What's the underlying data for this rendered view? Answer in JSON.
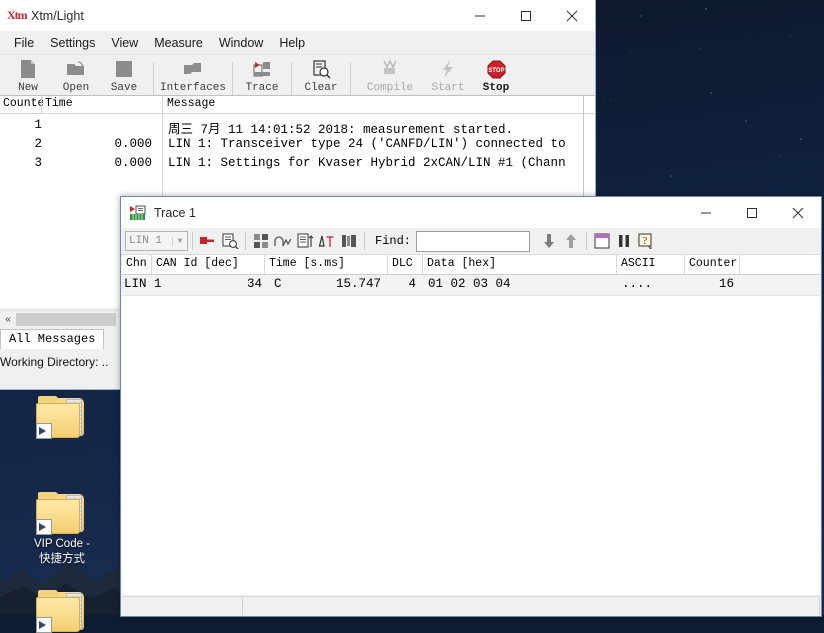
{
  "desktop": {
    "icons": [
      {
        "name": "folder-shortcut-top",
        "label": ""
      },
      {
        "name": "vip-code-shortcut",
        "label": "VIP Code -\n快捷方式"
      },
      {
        "name": "folder-shortcut-bottom",
        "label": ""
      }
    ],
    "vip_label_line1": "VIP Code -",
    "vip_label_line2": "快捷方式"
  },
  "main_window": {
    "title": "Xtm/Light",
    "logo_text": "Xtm",
    "controls": {
      "minimize": "minimize-icon",
      "maximize": "maximize-icon",
      "close": "close-icon"
    },
    "menu": [
      {
        "label": "File"
      },
      {
        "label": "Settings"
      },
      {
        "label": "View"
      },
      {
        "label": "Measure"
      },
      {
        "label": "Window"
      },
      {
        "label": "Help"
      }
    ],
    "toolbar": [
      {
        "label": "New",
        "icon": "new-file-icon",
        "enabled": true
      },
      {
        "label": "Open",
        "icon": "open-folder-icon",
        "enabled": true
      },
      {
        "label": "Save",
        "icon": "save-disk-icon",
        "enabled": true
      },
      {
        "label": "Interfaces",
        "icon": "interfaces-icon",
        "enabled": true
      },
      {
        "label": "Trace",
        "icon": "trace-icon",
        "enabled": true
      },
      {
        "label": "Clear",
        "icon": "clear-icon",
        "enabled": true
      },
      {
        "label": "Compile",
        "icon": "compile-icon",
        "enabled": false
      },
      {
        "label": "Start",
        "icon": "start-lightning-icon",
        "enabled": false
      },
      {
        "label": "Stop",
        "icon": "stop-sign-icon",
        "enabled": true
      }
    ],
    "message_list": {
      "columns": [
        "Counte",
        "Time",
        "Message"
      ],
      "rows": [
        {
          "counter": "1",
          "time": "",
          "message": "周三 7月 11 14:01:52 2018: measurement started."
        },
        {
          "counter": "2",
          "time": "0.000",
          "message": "LIN 1: Transceiver type 24 ('CANFD/LIN') connected to"
        },
        {
          "counter": "3",
          "time": "0.000",
          "message": "LIN 1: Settings for Kvaser Hybrid 2xCAN/LIN #1 (Chann"
        }
      ]
    },
    "scroll_left_arrow": "«",
    "tabs": [
      {
        "label": "All Messages",
        "active": true
      }
    ],
    "status_text": "Working Directory: .."
  },
  "trace_window": {
    "title": "Trace 1",
    "icon": "trace-window-icon",
    "controls": {
      "minimize": "minimize-icon",
      "maximize": "maximize-icon",
      "close": "close-icon"
    },
    "toolbar": {
      "channel_select": {
        "value": "LIN 1",
        "arrow": "chevron-down-icon"
      },
      "buttons": [
        {
          "icon": "marker-icon"
        },
        {
          "icon": "copy-document-icon"
        },
        {
          "icon": "grid-columns-icon"
        },
        {
          "icon": "waveform-icon"
        },
        {
          "icon": "sort-lines-icon"
        },
        {
          "icon": "delta-time-icon"
        },
        {
          "icon": "column-layout-icon"
        }
      ],
      "find_label": "Find:",
      "find_value": "",
      "find_placeholder": "",
      "find_next_icon": "arrow-down-icon",
      "find_prev_icon": "arrow-up-icon",
      "right_buttons": [
        {
          "icon": "window-view-icon"
        },
        {
          "icon": "pause-icon"
        },
        {
          "icon": "help-icon"
        }
      ]
    },
    "grid": {
      "columns": [
        "Chn",
        "CAN Id [dec]",
        "Time [s.ms]",
        "DLC",
        "Data [hex]",
        "ASCII",
        "Counter"
      ],
      "rows": [
        {
          "chn": "LIN 1",
          "can_id": "34",
          "can_id_flag": "C",
          "time": "15.747",
          "dlc": "4",
          "data": "01 02 03 04",
          "ascii": "....",
          "counter": "16"
        }
      ]
    }
  },
  "colors": {
    "desktop_bg": "#10203c",
    "window_chrome": "#f0f0f0",
    "title_bg": "#ffffff",
    "accent_red": "#c0272d",
    "stop_red": "#cc2127",
    "row_bg": "#f2f2f2",
    "folder_yellow": "#f3cf72",
    "border": "#6d8aa8"
  }
}
